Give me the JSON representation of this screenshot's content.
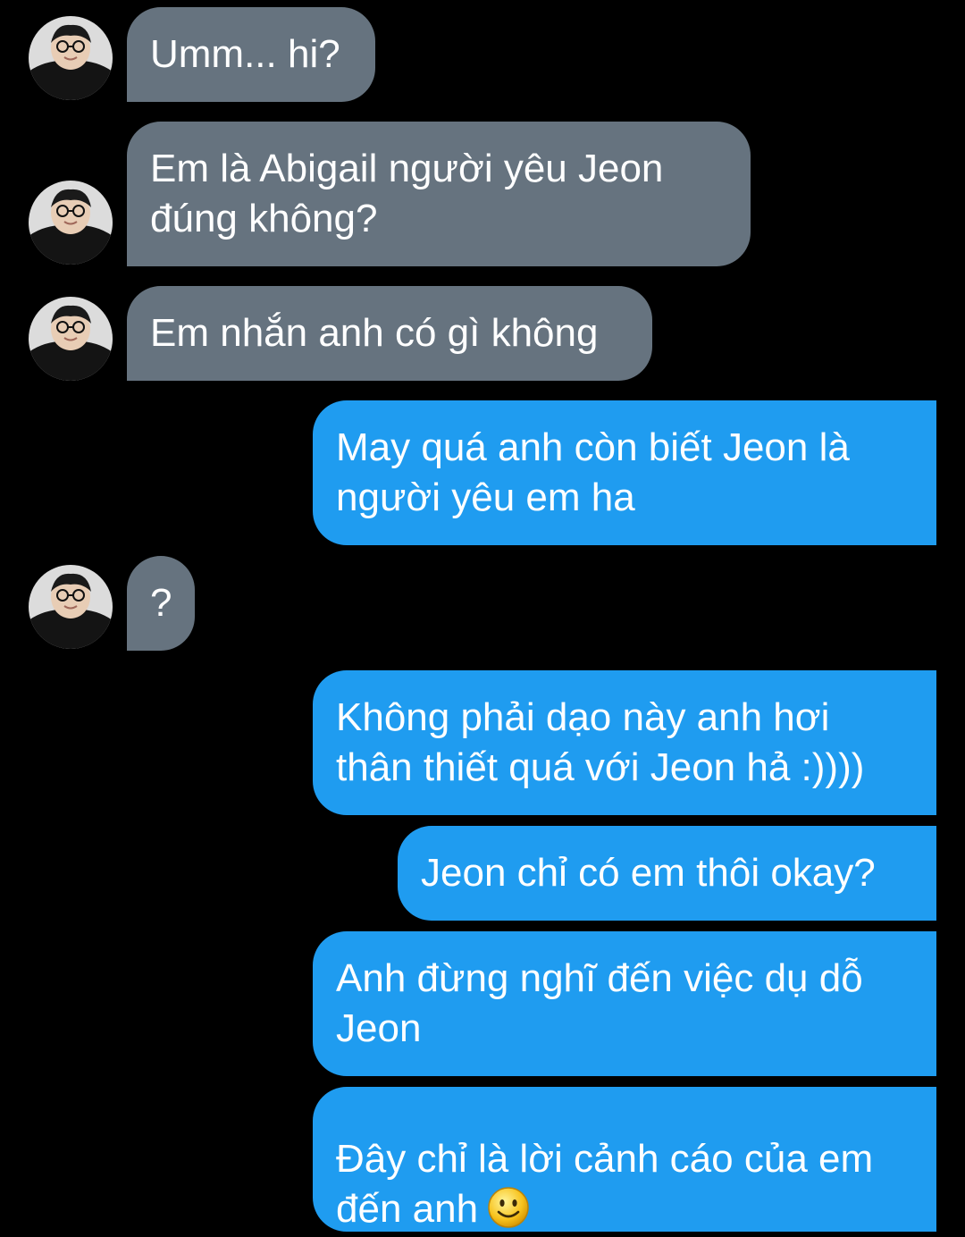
{
  "conversation": {
    "messages": [
      {
        "sender": "them",
        "text": "Umm... hi?"
      },
      {
        "sender": "them",
        "text": "Em là Abigail người yêu Jeon\nđúng không?"
      },
      {
        "sender": "them",
        "text": "Em nhắn anh có gì không"
      },
      {
        "sender": "me",
        "text": "May quá anh còn biết Jeon là\nngười yêu em ha"
      },
      {
        "sender": "them",
        "text": "?"
      },
      {
        "sender": "me",
        "text": "Không phải dạo này anh hơi\nthân thiết quá với Jeon hả :))))"
      },
      {
        "sender": "me",
        "text": "Jeon chỉ có em thôi okay?"
      },
      {
        "sender": "me",
        "text": "Anh đừng nghĩ đến việc dụ dỗ\nJeon"
      },
      {
        "sender": "me",
        "text": "Đây chỉ là lời cảnh cáo của em\nđến anh",
        "emoji": "smiley-emoji"
      }
    ]
  },
  "colors": {
    "background": "#000000",
    "incoming_bubble": "#66737f",
    "outgoing_bubble": "#1f9cf0",
    "text": "#ffffff"
  }
}
